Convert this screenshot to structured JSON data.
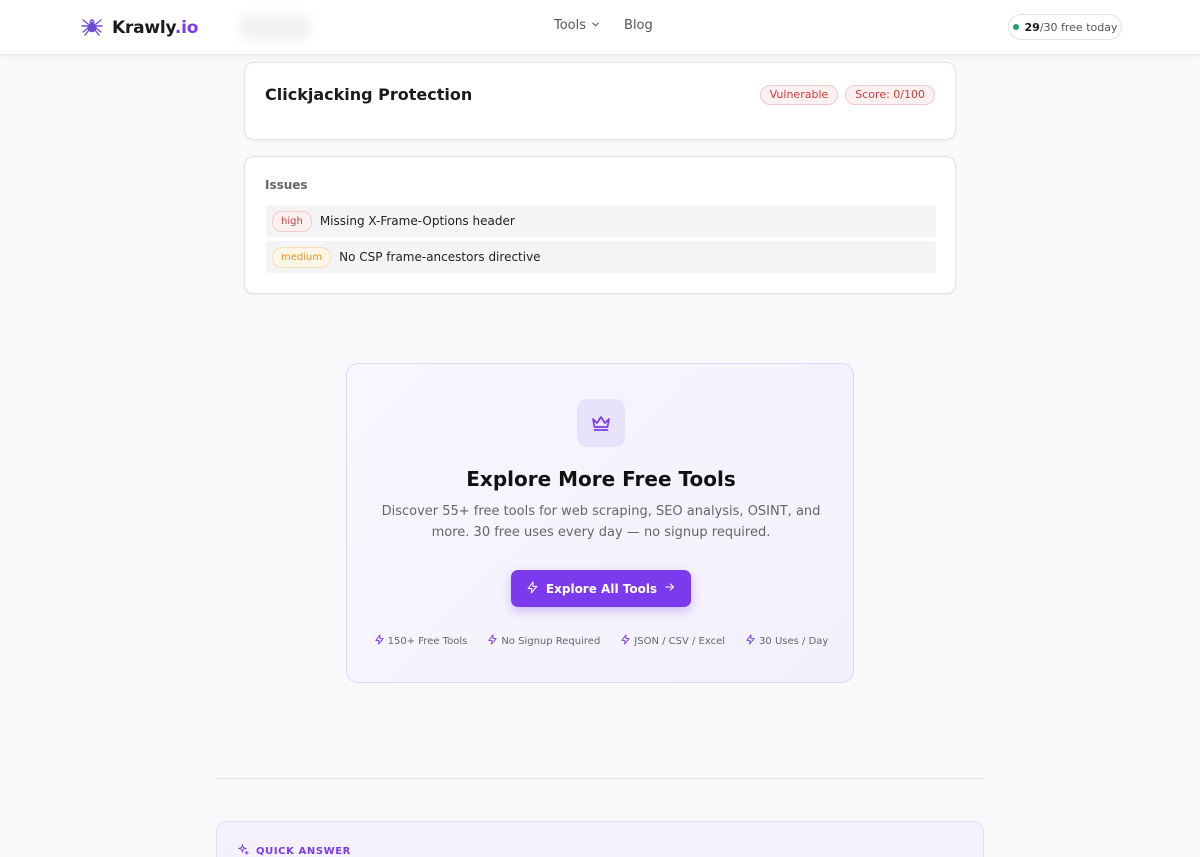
{
  "header": {
    "logo_name": "Krawly",
    "logo_tld": ".io",
    "nav": [
      {
        "label": "Tools",
        "has_dropdown": true
      },
      {
        "label": "Blog",
        "has_dropdown": false
      }
    ],
    "usage": {
      "used": "29",
      "total_text": "/30 free today"
    }
  },
  "result": {
    "title": "Clickjacking Protection",
    "status_badge": "Vulnerable",
    "score_badge": "Score: 0/100"
  },
  "issues": {
    "heading": "Issues",
    "items": [
      {
        "severity": "high",
        "text": "Missing X-Frame-Options header"
      },
      {
        "severity": "medium",
        "text": "No CSP frame-ancestors directive"
      }
    ]
  },
  "cta": {
    "icon": "crown-icon",
    "title": "Explore More Free Tools",
    "description": "Discover 55+ free tools for web scraping, SEO analysis, OSINT, and more. 30 free uses every day — no signup required.",
    "button_label": "Explore All Tools",
    "features": [
      "150+ Free Tools",
      "No Signup Required",
      "JSON / CSV / Excel",
      "30 Uses / Day"
    ]
  },
  "quick_answer": {
    "label": "QUICK ANSWER"
  },
  "colors": {
    "accent": "#7c3aed",
    "danger": "#d13b3b",
    "warning": "#e0951b",
    "success": "#22a06b"
  }
}
